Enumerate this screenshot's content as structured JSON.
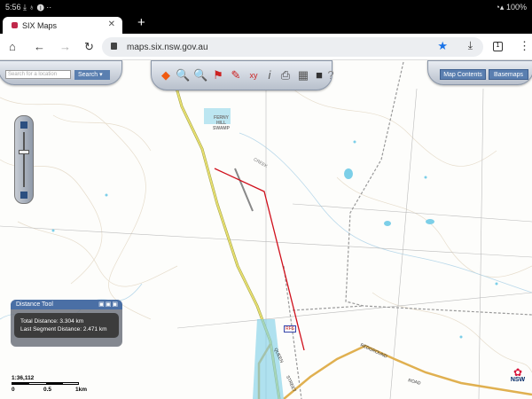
{
  "status": {
    "time": "5:56",
    "icons": "⤓ ♁ ❶ ··",
    "battery": "100%"
  },
  "browser": {
    "tab_title": "SIX Maps",
    "url": "maps.six.nsw.gov.au",
    "tab_count": "1"
  },
  "search": {
    "placeholder": "Search for a location",
    "button": "Search"
  },
  "toolbar": {
    "icons": [
      "nsw-state-icon",
      "zoom-out-icon",
      "zoom-in-icon",
      "area-measure-icon",
      "draw-icon",
      "xy-coordinate-icon",
      "identify-icon",
      "print-icon",
      "table-icon",
      "camera-icon",
      "help-icon"
    ]
  },
  "right": {
    "map_contents": "Map Contents",
    "basemaps": "Basemaps"
  },
  "distance_tool": {
    "title": "Distance Tool",
    "total": "Total Distance: 3.304 km",
    "last": "Last Segment Distance: 2.471 km"
  },
  "scale": {
    "ratio": "1:36,112",
    "t0": "0",
    "t1": "0.5",
    "t2": "1km"
  },
  "map_labels": {
    "swamp": "FERNY HILL SWAMP",
    "creek": "CREEK",
    "rfs": "RFS",
    "queen": "QUEEN",
    "street": "STREET",
    "redground": "REDGROUND",
    "road": "ROAD",
    "logo": "NSW"
  },
  "colors": {
    "measure_line": "#d0101c",
    "main_road": "#e8e070",
    "secondary_road": "#e0b050",
    "water": "#7ccfe8"
  }
}
